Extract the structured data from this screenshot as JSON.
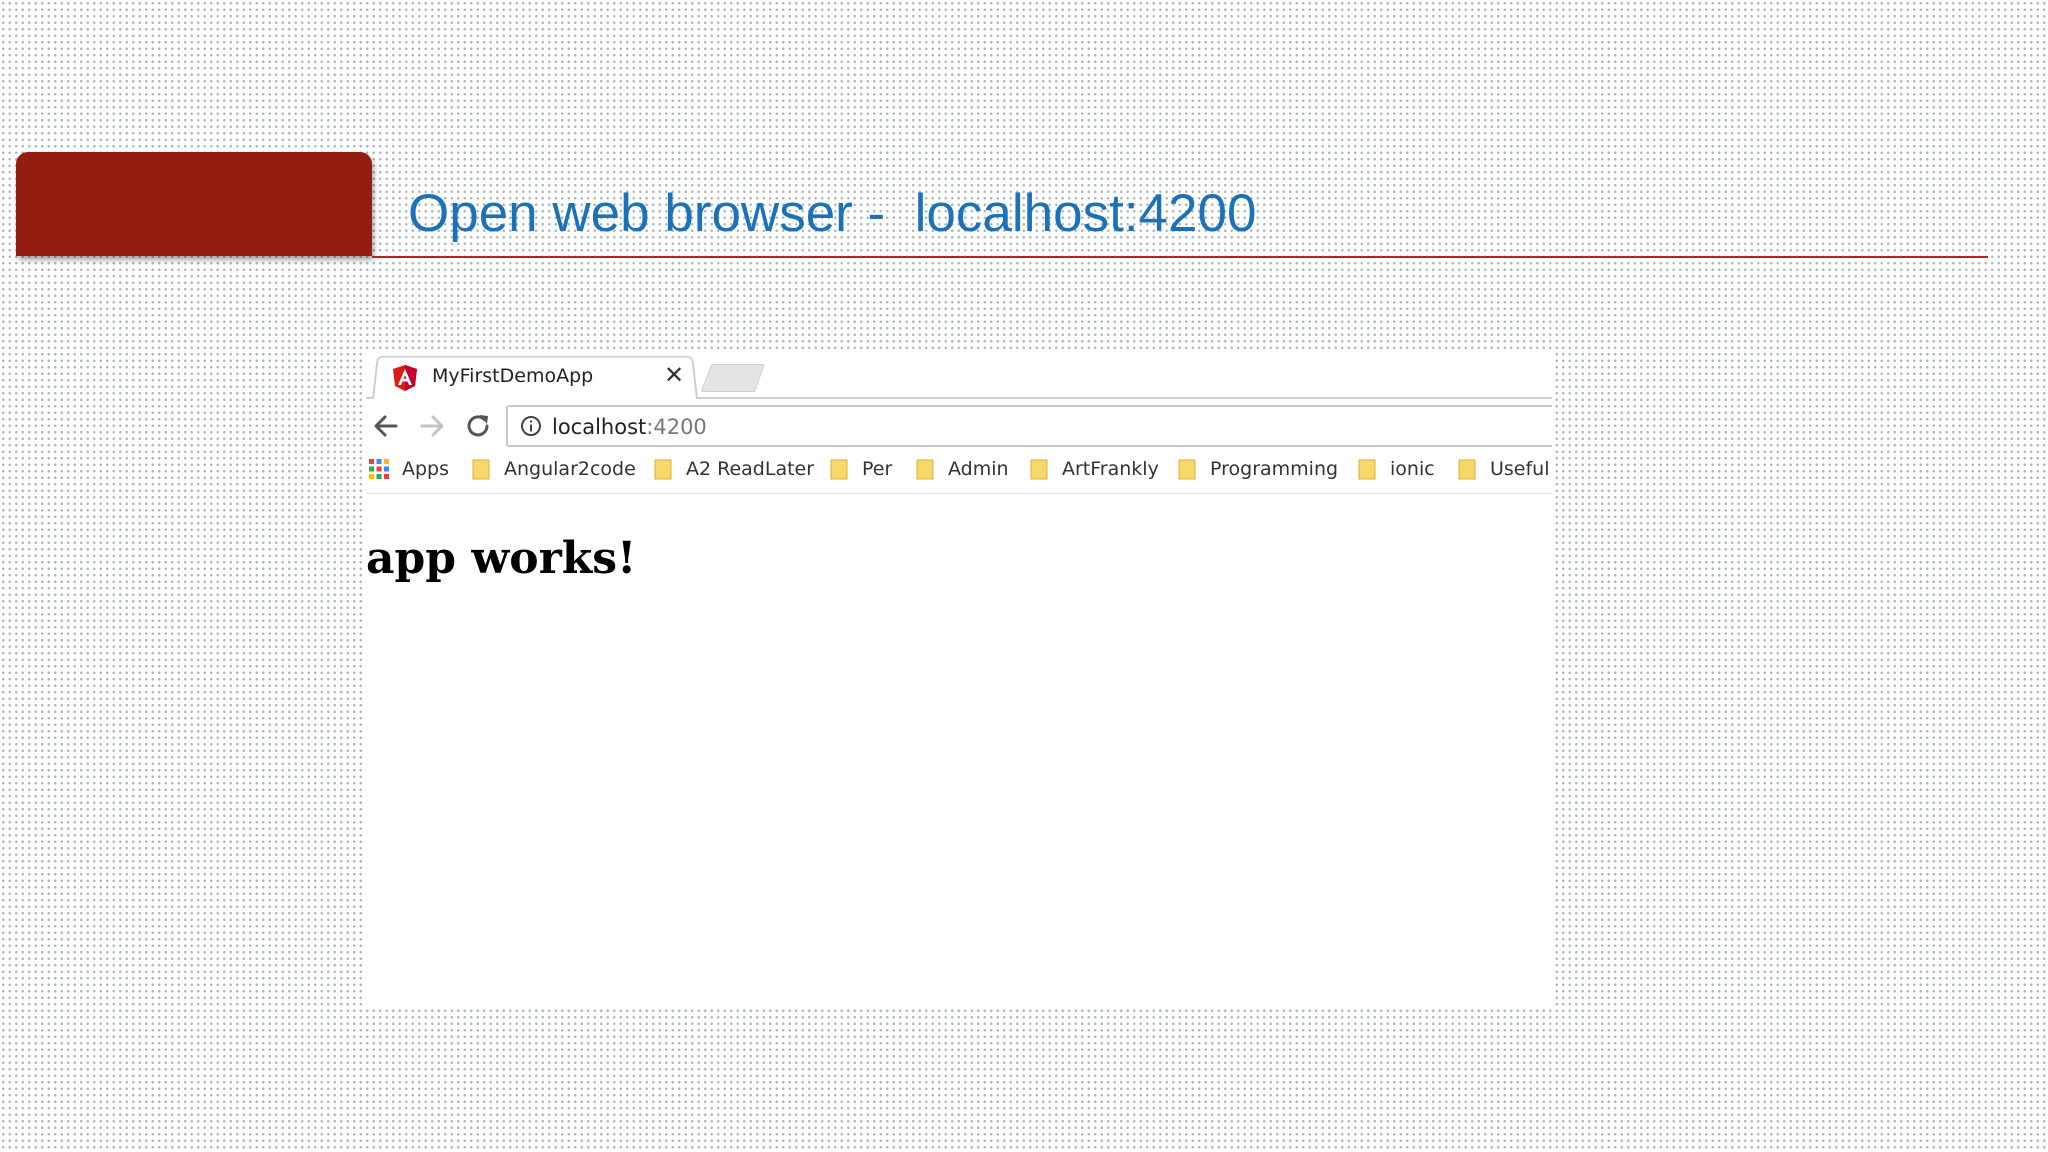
{
  "slide": {
    "title": "Open web browser -  localhost:4200",
    "accent_color": "#921d10",
    "title_color": "#1b72b8"
  },
  "browser": {
    "tab": {
      "title": "MyFirstDemoApp",
      "favicon": "angular-icon",
      "close_glyph": "✕"
    },
    "toolbar": {
      "back_icon": "back-arrow-icon",
      "forward_icon": "forward-arrow-icon",
      "reload_icon": "reload-icon",
      "site_info_icon": "info-icon",
      "url_host": "localhost",
      "url_port": ":4200"
    },
    "bookmarks": {
      "apps_label": "Apps",
      "items": [
        {
          "label": "Angular2code"
        },
        {
          "label": "A2 ReadLater"
        },
        {
          "label": "Per"
        },
        {
          "label": "Admin"
        },
        {
          "label": "ArtFrankly"
        },
        {
          "label": "Programming"
        },
        {
          "label": "ionic"
        },
        {
          "label": "Useful"
        }
      ]
    },
    "page": {
      "heading": "app works!"
    }
  }
}
